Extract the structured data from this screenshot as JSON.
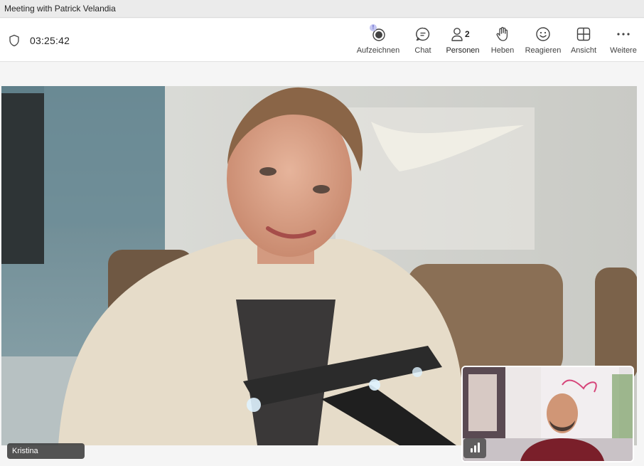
{
  "window": {
    "title": "Meeting with Patrick Velandia"
  },
  "meeting": {
    "duration": "03:25:42"
  },
  "toolbar": {
    "record_label": "Aufzeichnen",
    "chat_label": "Chat",
    "people_label": "Personen",
    "people_count": "2",
    "raise_label": "Heben",
    "react_label": "Reagieren",
    "view_label": "Ansicht",
    "more_label": "Weitere",
    "active_tab": "Personen",
    "accent_color": "#5b5fc7"
  },
  "main_video": {
    "participant_name": "Kristina"
  },
  "self_view": {
    "audio_indicator": "speaking-bars-icon"
  }
}
